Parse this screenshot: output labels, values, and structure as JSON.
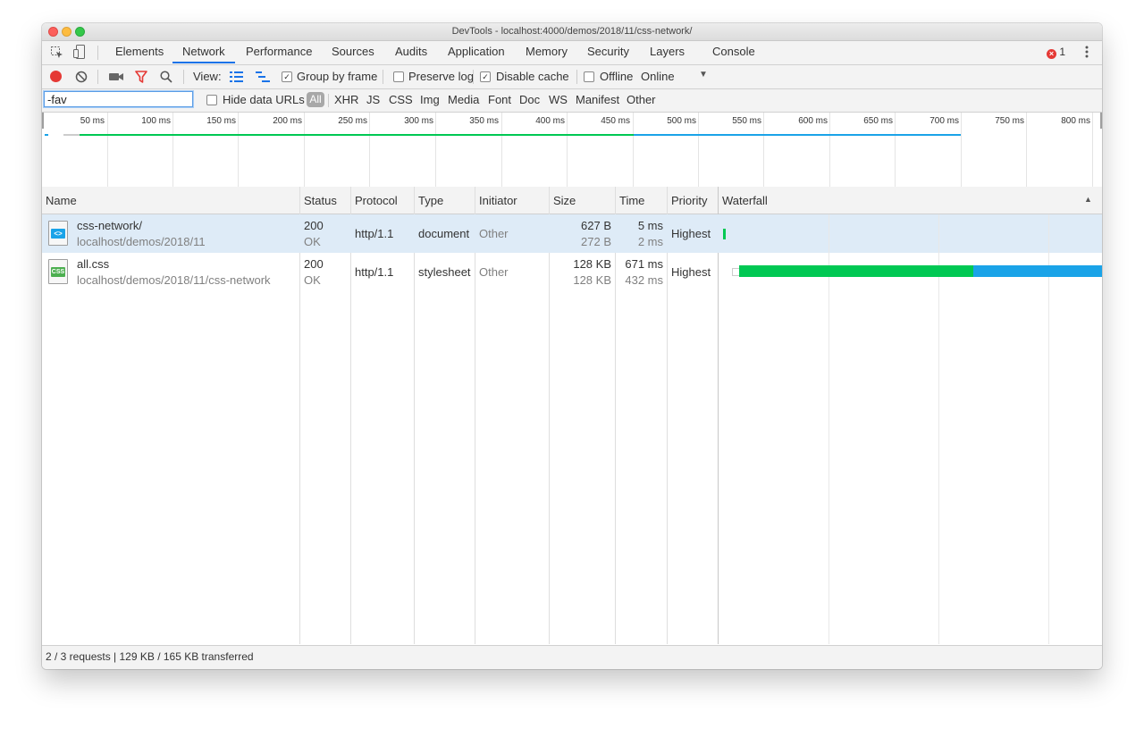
{
  "window": {
    "title": "DevTools - localhost:4000/demos/2018/11/css-network/"
  },
  "tabs": [
    "Elements",
    "Network",
    "Performance",
    "Sources",
    "Audits",
    "Application",
    "Memory",
    "Security",
    "Layers",
    "Console"
  ],
  "active_tab": "Network",
  "error_count": "1",
  "toolbar": {
    "view_label": "View:",
    "group_by_frame": "Group by frame",
    "preserve_log": "Preserve log",
    "disable_cache": "Disable cache",
    "offline": "Offline",
    "throttle": "Online",
    "group_by_frame_checked": true,
    "preserve_log_checked": false,
    "disable_cache_checked": true,
    "offline_checked": false
  },
  "filter": {
    "value": "-fav",
    "hide_data_urls": "Hide data URLs",
    "types": [
      "All",
      "XHR",
      "JS",
      "CSS",
      "Img",
      "Media",
      "Font",
      "Doc",
      "WS",
      "Manifest",
      "Other"
    ]
  },
  "overview_ticks": [
    "50 ms",
    "100 ms",
    "150 ms",
    "200 ms",
    "250 ms",
    "300 ms",
    "350 ms",
    "400 ms",
    "450 ms",
    "500 ms",
    "550 ms",
    "600 ms",
    "650 ms",
    "700 ms",
    "750 ms",
    "800 ms"
  ],
  "columns": [
    "Name",
    "Status",
    "Protocol",
    "Type",
    "Initiator",
    "Size",
    "Time",
    "Priority",
    "Waterfall"
  ],
  "requests": [
    {
      "name": "css-network/",
      "path": "localhost/demos/2018/11",
      "status": "200",
      "status_text": "OK",
      "protocol": "http/1.1",
      "type": "document",
      "initiator": "Other",
      "size": "627 B",
      "size_resource": "272 B",
      "time": "5 ms",
      "latency": "2 ms",
      "priority": "Highest",
      "icon": "html-document-icon",
      "icon_text": "<>"
    },
    {
      "name": "all.css",
      "path": "localhost/demos/2018/11/css-network",
      "status": "200",
      "status_text": "OK",
      "protocol": "http/1.1",
      "type": "stylesheet",
      "initiator": "Other",
      "size": "128 KB",
      "size_resource": "128 KB",
      "time": "671 ms",
      "latency": "432 ms",
      "priority": "Highest",
      "icon": "css-file-icon",
      "icon_text": "CSS"
    }
  ],
  "status_bar": "2 / 3 requests | 129 KB / 165 KB transferred",
  "colors": {
    "accent": "#1a73e8",
    "waiting": "#00c853",
    "download": "#1aa3e8",
    "selected_row": "#deebf7",
    "record": "#e53935"
  }
}
